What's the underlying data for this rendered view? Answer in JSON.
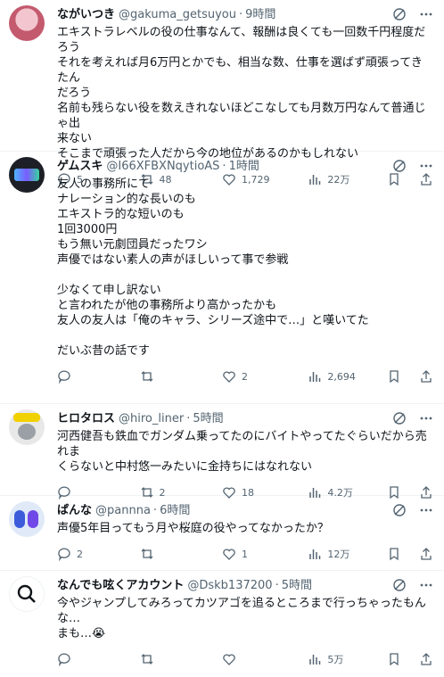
{
  "tweets": [
    {
      "name": "ながいつき",
      "handle": "@gakuma_getsuyou",
      "time": "9時間",
      "text": "エキストラレベルの役の仕事なんて、報酬は良くても一回数千円程度だろう\nそれを考えれば月6万円とかでも、相当な数、仕事を選ばず頑張ってきたん\nだろう\n名前も残らない役を数えきれないほどこなしても月数万円なんて普通じゃ出\n来ない\nそこまで頑張った人だから今の地位があるのかもしれない",
      "replies": "5",
      "retweets": "48",
      "likes": "1,729",
      "views": "22万"
    },
    {
      "name": "ゲムスキ",
      "handle": "@I66XFBXNqytioAS",
      "time": "1時間",
      "text": "友人の事務所にて\nナレーション的な長いのも\nエキストラ的な短いのも\n1回3000円\nもう無い元劇団員だったワシ\n声優ではない素人の声がほしいって事で参戦\n\n少なくて申し訳ない\nと言われたが他の事務所より高かったかも\n友人の友人は「俺のキャラ、シリーズ途中で…」と嘆いてた\n\nだいぶ昔の話です",
      "replies": "",
      "retweets": "",
      "likes": "2",
      "views": "2,694"
    },
    {
      "name": "ヒロタロス",
      "handle": "@hiro_liner",
      "time": "5時間",
      "text": "河西健吾も鉄血でガンダム乗ってたのにバイトやってたぐらいだから売れま\nくらないと中村悠一みたいに金持ちにはなれない",
      "replies": "",
      "retweets": "2",
      "likes": "18",
      "views": "4.2万"
    },
    {
      "name": "ぱんな",
      "handle": "@pannna",
      "time": "6時間",
      "text": "声優5年目ってもう月や桜庭の役やってなかったか？",
      "replies": "2",
      "retweets": "",
      "likes": "1",
      "views": "12万"
    },
    {
      "name": "なんでも呟くアカウント",
      "handle": "@Dskb137200",
      "time": "5時間",
      "text": "今やジャンプしてみろってカツアゴを追るところまで行っちゃったもんな…\nまも…😭",
      "replies": "",
      "retweets": "",
      "likes": "",
      "views": "5万"
    }
  ],
  "colors": {
    "text": "#0f1419",
    "muted": "#536471",
    "border": "#eff3f4"
  }
}
